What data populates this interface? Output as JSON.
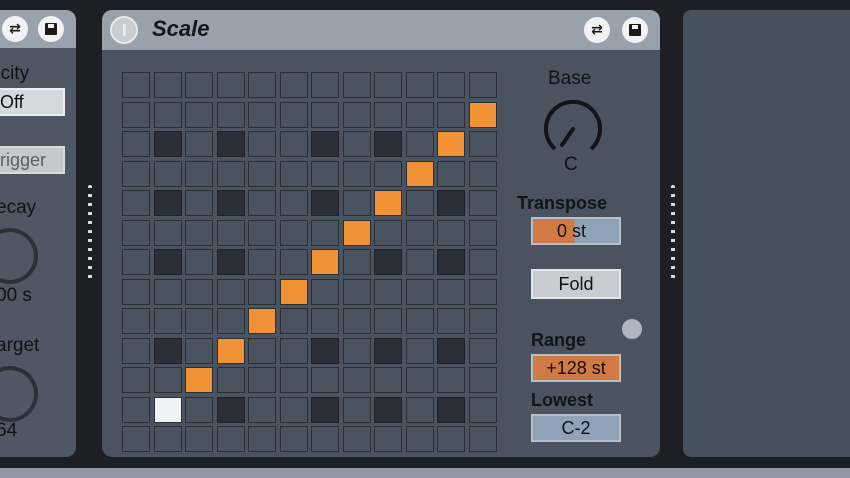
{
  "left_device": {
    "labels": {
      "velocity": "ocity",
      "off_toggle": "Off",
      "trigger_button": "rigger",
      "decay": "ecay",
      "decay_value": "00 s",
      "target": "arget",
      "target_value": "64"
    },
    "icons": [
      "hot-swap-icon",
      "save-icon"
    ]
  },
  "scale_device": {
    "title": "Scale",
    "icons": [
      "power-icon",
      "hot-swap-icon",
      "save-icon"
    ],
    "grid": {
      "rows": 13,
      "cols": 12,
      "dark_cells": [
        [
          2,
          1
        ],
        [
          2,
          3
        ],
        [
          2,
          6
        ],
        [
          2,
          8
        ],
        [
          4,
          1
        ],
        [
          4,
          3
        ],
        [
          4,
          6
        ],
        [
          4,
          8
        ],
        [
          4,
          10
        ],
        [
          6,
          1
        ],
        [
          6,
          3
        ],
        [
          6,
          6
        ],
        [
          6,
          8
        ],
        [
          6,
          10
        ],
        [
          9,
          1
        ],
        [
          9,
          6
        ],
        [
          9,
          8
        ],
        [
          9,
          10
        ],
        [
          11,
          3
        ],
        [
          11,
          6
        ],
        [
          11,
          8
        ],
        [
          11,
          10
        ]
      ],
      "orange_cells": [
        [
          1,
          11
        ],
        [
          2,
          10
        ],
        [
          3,
          9
        ],
        [
          4,
          8
        ],
        [
          5,
          7
        ],
        [
          6,
          6
        ],
        [
          7,
          5
        ],
        [
          8,
          4
        ],
        [
          9,
          3
        ],
        [
          10,
          2
        ]
      ],
      "white_cells": [
        [
          11,
          1
        ]
      ]
    },
    "base": {
      "label": "Base",
      "value": "C"
    },
    "transpose": {
      "label": "Transpose",
      "value": "0 st"
    },
    "fold_button": "Fold",
    "range": {
      "label": "Range",
      "value": "+128 st"
    },
    "lowest": {
      "label": "Lowest",
      "value": "C-2"
    }
  },
  "colors": {
    "orange_accent": "#f29237",
    "panel": "#4a5460",
    "titlebar": "#98a1ac"
  }
}
